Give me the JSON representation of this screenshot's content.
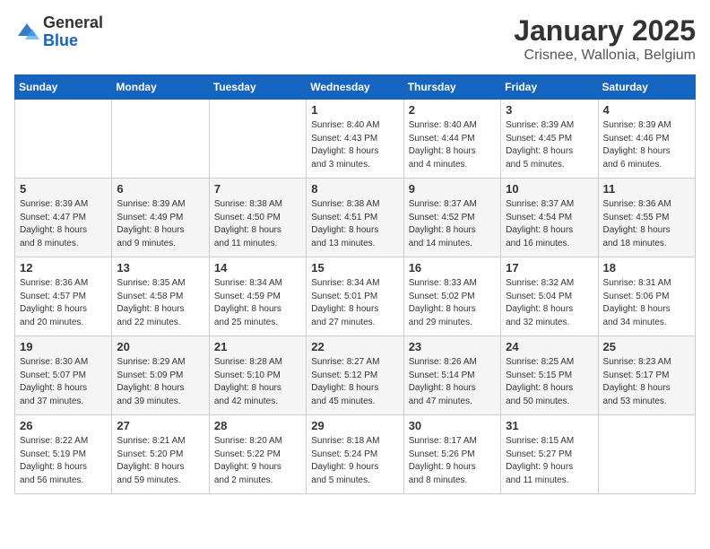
{
  "header": {
    "logo_general": "General",
    "logo_blue": "Blue",
    "month_title": "January 2025",
    "location": "Crisnee, Wallonia, Belgium"
  },
  "weekdays": [
    "Sunday",
    "Monday",
    "Tuesday",
    "Wednesday",
    "Thursday",
    "Friday",
    "Saturday"
  ],
  "weeks": [
    [
      {
        "day": "",
        "info": ""
      },
      {
        "day": "",
        "info": ""
      },
      {
        "day": "",
        "info": ""
      },
      {
        "day": "1",
        "info": "Sunrise: 8:40 AM\nSunset: 4:43 PM\nDaylight: 8 hours\nand 3 minutes."
      },
      {
        "day": "2",
        "info": "Sunrise: 8:40 AM\nSunset: 4:44 PM\nDaylight: 8 hours\nand 4 minutes."
      },
      {
        "day": "3",
        "info": "Sunrise: 8:39 AM\nSunset: 4:45 PM\nDaylight: 8 hours\nand 5 minutes."
      },
      {
        "day": "4",
        "info": "Sunrise: 8:39 AM\nSunset: 4:46 PM\nDaylight: 8 hours\nand 6 minutes."
      }
    ],
    [
      {
        "day": "5",
        "info": "Sunrise: 8:39 AM\nSunset: 4:47 PM\nDaylight: 8 hours\nand 8 minutes."
      },
      {
        "day": "6",
        "info": "Sunrise: 8:39 AM\nSunset: 4:49 PM\nDaylight: 8 hours\nand 9 minutes."
      },
      {
        "day": "7",
        "info": "Sunrise: 8:38 AM\nSunset: 4:50 PM\nDaylight: 8 hours\nand 11 minutes."
      },
      {
        "day": "8",
        "info": "Sunrise: 8:38 AM\nSunset: 4:51 PM\nDaylight: 8 hours\nand 13 minutes."
      },
      {
        "day": "9",
        "info": "Sunrise: 8:37 AM\nSunset: 4:52 PM\nDaylight: 8 hours\nand 14 minutes."
      },
      {
        "day": "10",
        "info": "Sunrise: 8:37 AM\nSunset: 4:54 PM\nDaylight: 8 hours\nand 16 minutes."
      },
      {
        "day": "11",
        "info": "Sunrise: 8:36 AM\nSunset: 4:55 PM\nDaylight: 8 hours\nand 18 minutes."
      }
    ],
    [
      {
        "day": "12",
        "info": "Sunrise: 8:36 AM\nSunset: 4:57 PM\nDaylight: 8 hours\nand 20 minutes."
      },
      {
        "day": "13",
        "info": "Sunrise: 8:35 AM\nSunset: 4:58 PM\nDaylight: 8 hours\nand 22 minutes."
      },
      {
        "day": "14",
        "info": "Sunrise: 8:34 AM\nSunset: 4:59 PM\nDaylight: 8 hours\nand 25 minutes."
      },
      {
        "day": "15",
        "info": "Sunrise: 8:34 AM\nSunset: 5:01 PM\nDaylight: 8 hours\nand 27 minutes."
      },
      {
        "day": "16",
        "info": "Sunrise: 8:33 AM\nSunset: 5:02 PM\nDaylight: 8 hours\nand 29 minutes."
      },
      {
        "day": "17",
        "info": "Sunrise: 8:32 AM\nSunset: 5:04 PM\nDaylight: 8 hours\nand 32 minutes."
      },
      {
        "day": "18",
        "info": "Sunrise: 8:31 AM\nSunset: 5:06 PM\nDaylight: 8 hours\nand 34 minutes."
      }
    ],
    [
      {
        "day": "19",
        "info": "Sunrise: 8:30 AM\nSunset: 5:07 PM\nDaylight: 8 hours\nand 37 minutes."
      },
      {
        "day": "20",
        "info": "Sunrise: 8:29 AM\nSunset: 5:09 PM\nDaylight: 8 hours\nand 39 minutes."
      },
      {
        "day": "21",
        "info": "Sunrise: 8:28 AM\nSunset: 5:10 PM\nDaylight: 8 hours\nand 42 minutes."
      },
      {
        "day": "22",
        "info": "Sunrise: 8:27 AM\nSunset: 5:12 PM\nDaylight: 8 hours\nand 45 minutes."
      },
      {
        "day": "23",
        "info": "Sunrise: 8:26 AM\nSunset: 5:14 PM\nDaylight: 8 hours\nand 47 minutes."
      },
      {
        "day": "24",
        "info": "Sunrise: 8:25 AM\nSunset: 5:15 PM\nDaylight: 8 hours\nand 50 minutes."
      },
      {
        "day": "25",
        "info": "Sunrise: 8:23 AM\nSunset: 5:17 PM\nDaylight: 8 hours\nand 53 minutes."
      }
    ],
    [
      {
        "day": "26",
        "info": "Sunrise: 8:22 AM\nSunset: 5:19 PM\nDaylight: 8 hours\nand 56 minutes."
      },
      {
        "day": "27",
        "info": "Sunrise: 8:21 AM\nSunset: 5:20 PM\nDaylight: 8 hours\nand 59 minutes."
      },
      {
        "day": "28",
        "info": "Sunrise: 8:20 AM\nSunset: 5:22 PM\nDaylight: 9 hours\nand 2 minutes."
      },
      {
        "day": "29",
        "info": "Sunrise: 8:18 AM\nSunset: 5:24 PM\nDaylight: 9 hours\nand 5 minutes."
      },
      {
        "day": "30",
        "info": "Sunrise: 8:17 AM\nSunset: 5:26 PM\nDaylight: 9 hours\nand 8 minutes."
      },
      {
        "day": "31",
        "info": "Sunrise: 8:15 AM\nSunset: 5:27 PM\nDaylight: 9 hours\nand 11 minutes."
      },
      {
        "day": "",
        "info": ""
      }
    ]
  ]
}
